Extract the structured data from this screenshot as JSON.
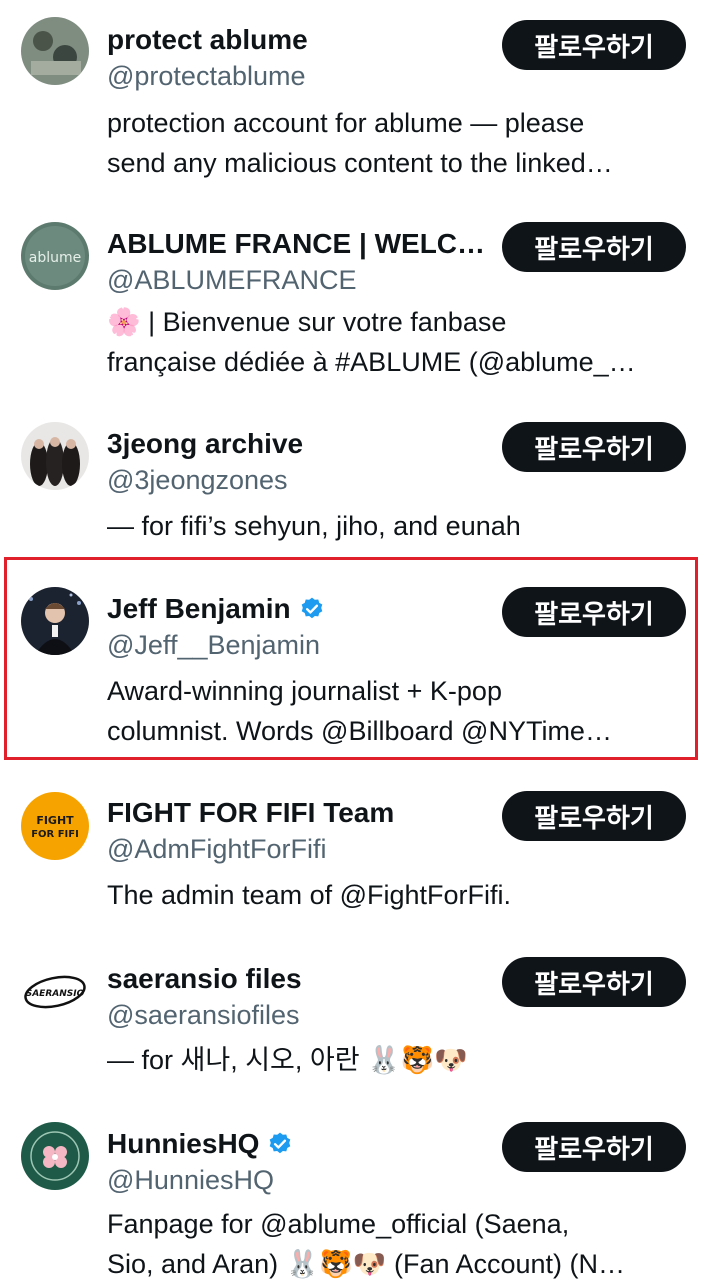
{
  "follow_label": "팔로우하기",
  "accent_color": "#1d9bf0",
  "highlight_color": "#e0202a",
  "users": [
    {
      "name": "protect ablume",
      "handle": "@protectablume",
      "verified": false,
      "bio": [
        "protection account for ablume — please",
        "send any malicious content to the linked…"
      ]
    },
    {
      "name": "ABLUME FRANCE | WELC…",
      "handle": "@ABLUMEFRANCE",
      "verified": false,
      "bio": [
        "🌸 | Bienvenue sur votre fanbase",
        "française dédiée à #ABLUME (@ablume_…"
      ]
    },
    {
      "name": "3jeong archive",
      "handle": "@3jeongzones",
      "verified": false,
      "bio": [
        "— for fifi’s sehyun, jiho, and eunah"
      ]
    },
    {
      "name": "Jeff Benjamin",
      "handle": "@Jeff__Benjamin",
      "verified": true,
      "bio": [
        "Award-winning journalist + K-pop",
        "columnist. Words @Billboard @NYTime…"
      ]
    },
    {
      "name": "FIGHT FOR FIFI Team",
      "handle": "@AdmFightForFifi",
      "verified": false,
      "bio": [
        "The admin team of @FightForFifi."
      ]
    },
    {
      "name": "saeransio files",
      "handle": "@saeransiofiles",
      "verified": false,
      "bio": [
        "— for 새나, 시오, 아란 🐰🐯🐶"
      ]
    },
    {
      "name": "HunniesHQ",
      "handle": "@HunniesHQ",
      "verified": true,
      "bio": [
        "Fanpage for @ablume_official (Saena,",
        "Sio, and Aran) 🐰🐯🐶 (Fan Account) (N…"
      ]
    }
  ],
  "avatar_text": {
    "ablume_france": "ablume",
    "fight_for_fifi": "FIGHT FOR FIFI",
    "saeransio": "SAERANSIO"
  }
}
